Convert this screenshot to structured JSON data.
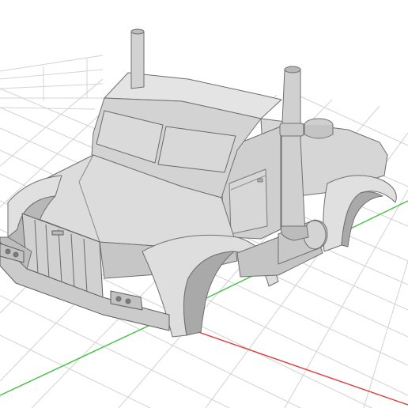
{
  "app": {
    "window_title": "",
    "description_text": ""
  },
  "scene": {
    "background_color": "#ffffff",
    "grid_line_color": "#d4d4d4",
    "x_axis_color": "#e03a3a",
    "y_axis_color": "#40c040",
    "model_fill_color": "#d9d9d9",
    "model_shadow_color": "#a7a7a7",
    "model_edge_color": "#6f6f6f",
    "model_name": "",
    "view_mode": "3d-perspective"
  }
}
